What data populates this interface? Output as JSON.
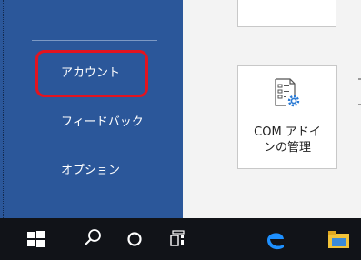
{
  "sidebar": {
    "items": [
      {
        "label": "アカウント"
      },
      {
        "label": "フィードバック"
      },
      {
        "label": "オプション"
      }
    ]
  },
  "content": {
    "com_addins_button": {
      "label": "COM アドイ\nンの管理",
      "icon": "com-addin-icon"
    }
  },
  "taskbar": {
    "icons": [
      "windows-start-icon",
      "search-icon",
      "cortana-icon",
      "task-view-icon",
      "edge-icon",
      "file-explorer-icon"
    ]
  },
  "colors": {
    "sidebar": "#2b579a",
    "highlight": "#e3141f",
    "taskbar": "#111318",
    "content_bg": "#f3f3f3"
  }
}
